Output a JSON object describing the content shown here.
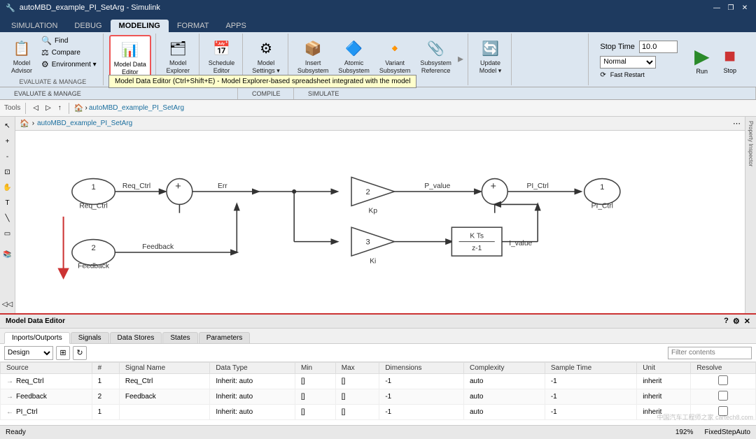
{
  "titleBar": {
    "title": "autoMBD_example_PI_SetArg - Simulink",
    "controls": [
      "minimize",
      "restore",
      "close"
    ]
  },
  "menuTabs": [
    "SIMULATION",
    "DEBUG",
    "MODELING",
    "FORMAT",
    "APPS"
  ],
  "activeTab": "MODELING",
  "ribbon": {
    "groups": [
      {
        "label": "EVALUATE & MANAGE",
        "items": [
          {
            "label": "Model\nAdvisor",
            "icon": "📋"
          },
          {
            "label": "Find",
            "icon": "🔍",
            "small": true
          },
          {
            "label": "Compare",
            "icon": "⚖",
            "small": true
          },
          {
            "label": "Environment",
            "icon": "⚙",
            "small": true
          }
        ]
      },
      {
        "label": "",
        "items": [
          {
            "label": "Model Data\nEditor",
            "icon": "📊",
            "highlighted": true
          }
        ]
      },
      {
        "label": "",
        "items": [
          {
            "label": "Model\nExplorer",
            "icon": "🗂"
          }
        ]
      },
      {
        "label": "",
        "items": [
          {
            "label": "Schedule\nEditor",
            "icon": "📅"
          }
        ]
      },
      {
        "label": "",
        "items": [
          {
            "label": "Model\nSettings",
            "icon": "⚙"
          }
        ]
      },
      {
        "label": "",
        "items": [
          {
            "label": "Insert\nSubsystem",
            "icon": "📦"
          },
          {
            "label": "Atomic\nSubsystem",
            "icon": "🔷"
          },
          {
            "label": "Variant\nSubsystem",
            "icon": "🔸"
          },
          {
            "label": "Subsystem\nReference",
            "icon": "📎"
          }
        ]
      },
      {
        "label": "",
        "items": [
          {
            "label": "Update\nModel",
            "icon": "🔄"
          }
        ]
      }
    ],
    "stopTime": {
      "label": "Stop Time",
      "value": "10.0",
      "mode": "Normal"
    },
    "sections": [
      "EVALUATE & MANAGE",
      "COMPILE",
      "SIMULATE"
    ],
    "compile_label": "COMPILE",
    "simulate_label": "SIMULATE"
  },
  "toolbar": {
    "tools_label": "Tools",
    "breadcrumb": "autoMBD_example_PI_SetArg"
  },
  "tooltip": {
    "text": "Model Data Editor (Ctrl+Shift+E) - Model Explorer-based spreadsheet integrated with the model"
  },
  "diagram": {
    "title": "autoMBD_example_PI_SetArg"
  },
  "bottomPanel": {
    "title": "Model Data Editor",
    "tabs": [
      "Inports/Outports",
      "Signals",
      "Data Stores",
      "States",
      "Parameters"
    ],
    "activeTab": "Inports/Outports",
    "toolbar": {
      "selectValue": "Design",
      "filterPlaceholder": "Filter contents"
    },
    "columns": [
      "Source",
      "#",
      "Signal Name",
      "Data Type",
      "Min",
      "Max",
      "Dimensions",
      "Complexity",
      "Sample Time",
      "Unit",
      "Resolve"
    ],
    "rows": [
      {
        "arrow": "→",
        "source": "Req_Ctrl",
        "num": "1",
        "signalName": "Req_Ctrl",
        "dataType": "Inherit: auto",
        "min": "[]",
        "max": "[]",
        "dimensions": "-1",
        "complexity": "auto",
        "sampleTime": "-1",
        "unit": "inherit",
        "resolve": false
      },
      {
        "arrow": "→",
        "source": "Feedback",
        "num": "2",
        "signalName": "Feedback",
        "dataType": "Inherit: auto",
        "min": "[]",
        "max": "[]",
        "dimensions": "-1",
        "complexity": "auto",
        "sampleTime": "-1",
        "unit": "inherit",
        "resolve": false
      },
      {
        "arrow": "←",
        "source": "PI_Ctrl",
        "num": "1",
        "signalName": "",
        "dataType": "Inherit: auto",
        "min": "[]",
        "max": "[]",
        "dimensions": "-1",
        "complexity": "auto",
        "sampleTime": "-1",
        "unit": "inherit",
        "resolve": false
      }
    ]
  },
  "statusBar": {
    "ready": "Ready",
    "zoom": "192%",
    "fixed_step": "FixedStepAuto"
  },
  "icons": {
    "minimize": "—",
    "restore": "❐",
    "close": "✕",
    "run": "▶",
    "stop": "■",
    "fast_restart": "⟳",
    "question": "?",
    "close_panel": "✕",
    "expand_arrow": "◀◀"
  }
}
